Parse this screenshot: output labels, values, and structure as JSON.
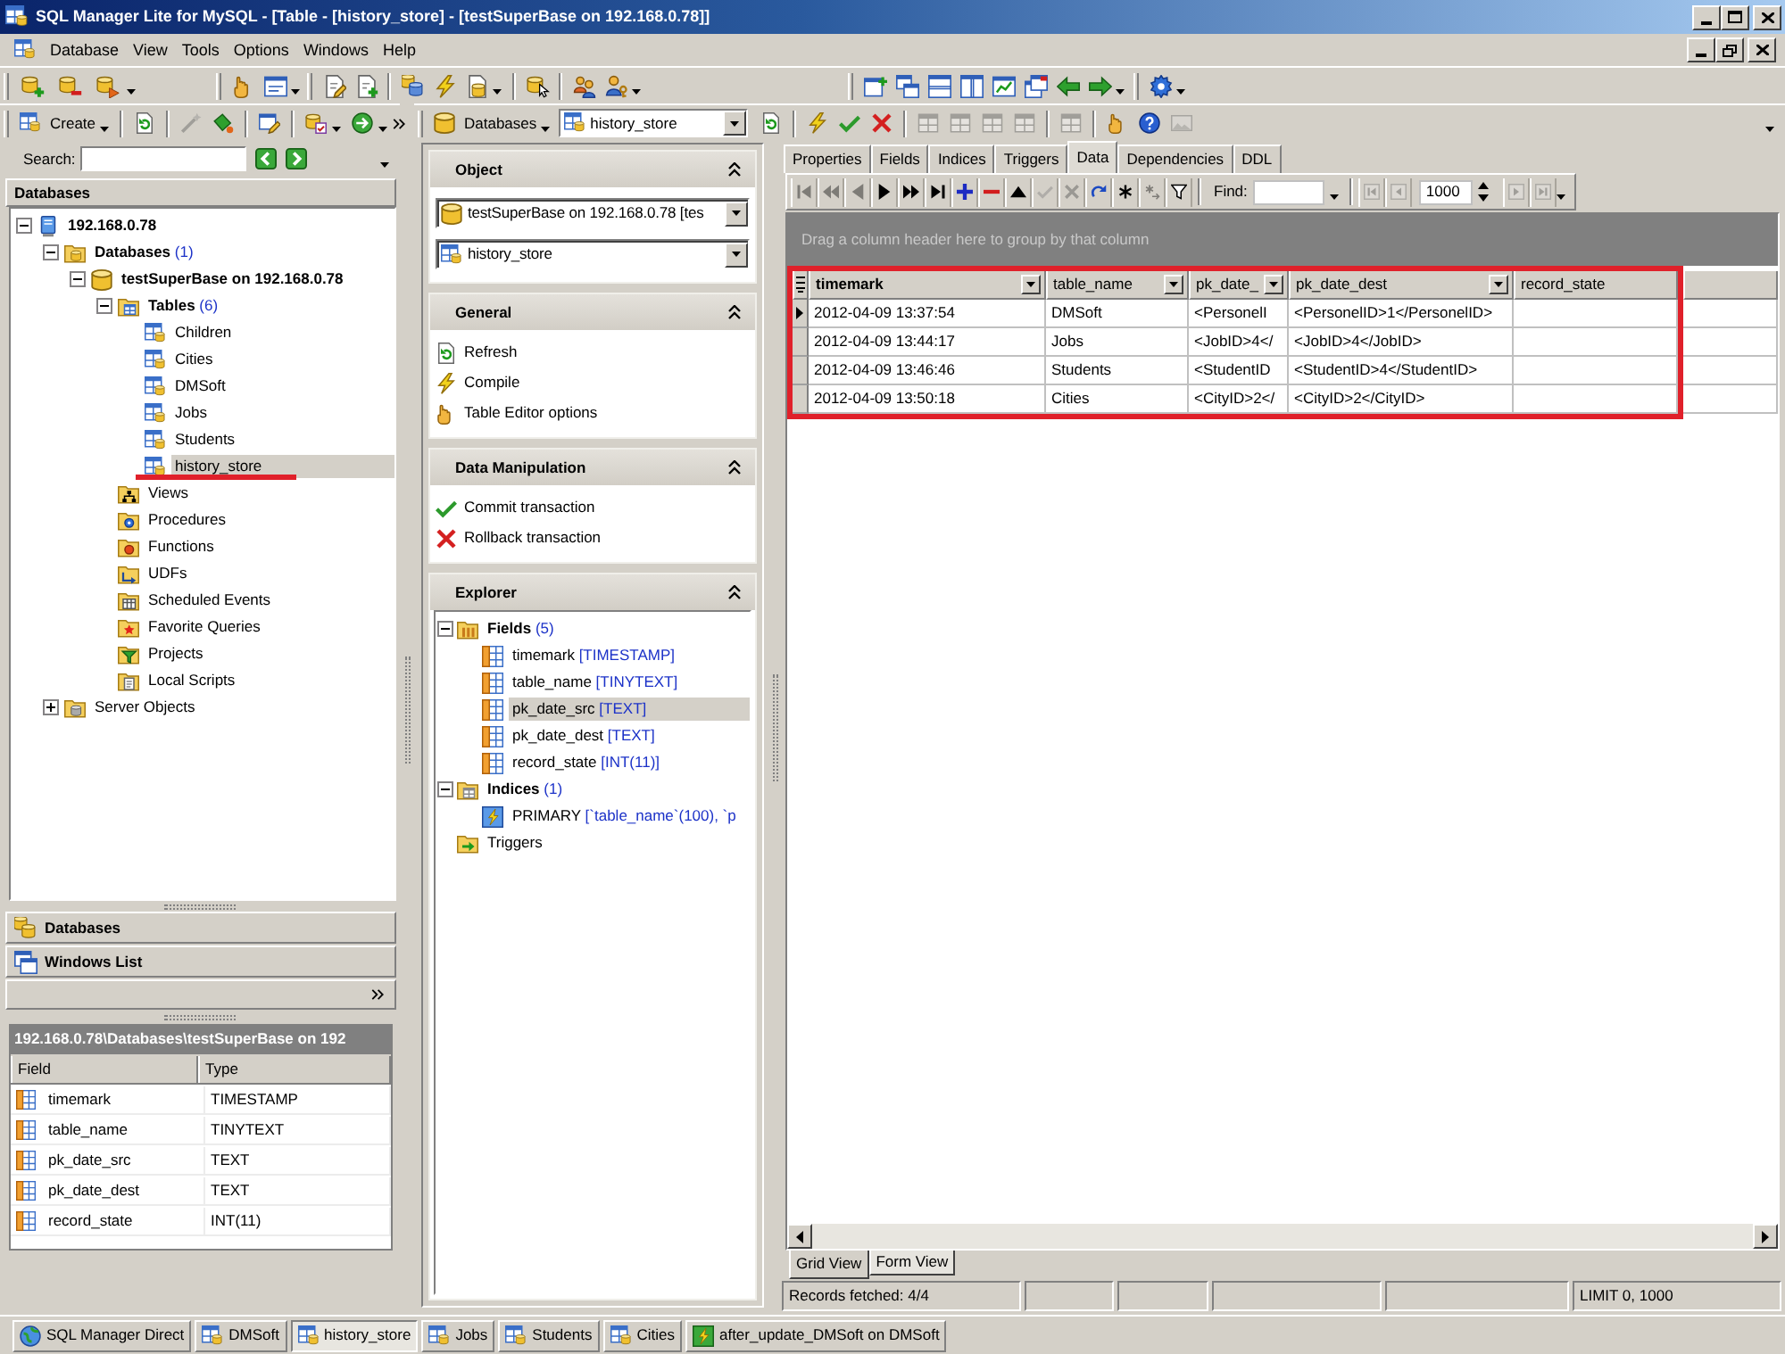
{
  "window": {
    "title": "SQL Manager Lite for MySQL - [Table - [history_store] - [testSuperBase on 192.168.0.78]]"
  },
  "menu": [
    "Database",
    "View",
    "Tools",
    "Options",
    "Windows",
    "Help"
  ],
  "main_toolbar": {
    "bands": [
      {
        "items": [
          {
            "kind": "dbplus"
          },
          {
            "kind": "dbminus"
          },
          {
            "kind": "dbarrow"
          },
          {
            "kind": "drop"
          }
        ]
      },
      {
        "items": [
          {
            "kind": "hand"
          },
          {
            "kind": "window"
          },
          {
            "kind": "drop"
          }
        ]
      },
      {
        "items": [
          {
            "kind": "edit"
          },
          {
            "kind": "newdoc"
          },
          {
            "kind": "sep"
          },
          {
            "kind": "dbconnect"
          },
          {
            "kind": "lightning"
          },
          {
            "kind": "newobj"
          },
          {
            "kind": "drop"
          },
          {
            "kind": "sep"
          },
          {
            "kind": "dbcursor"
          },
          {
            "kind": "sep"
          },
          {
            "kind": "users"
          },
          {
            "kind": "userkey"
          },
          {
            "kind": "drop"
          }
        ]
      },
      {
        "items": [
          {
            "kind": "winnew"
          },
          {
            "kind": "cascade"
          },
          {
            "kind": "tileh"
          },
          {
            "kind": "tilev"
          },
          {
            "kind": "winchart"
          },
          {
            "kind": "winclose"
          },
          {
            "kind": "back"
          },
          {
            "kind": "forward"
          },
          {
            "kind": "drop"
          }
        ]
      },
      {
        "items": [
          {
            "kind": "gear"
          },
          {
            "kind": "drop"
          }
        ]
      }
    ]
  },
  "navigator": {
    "toolbar": [
      {
        "kind": "create",
        "label": "Create",
        "disabled": false
      },
      {
        "kind": "drop"
      },
      {
        "kind": "sep"
      },
      {
        "kind": "refresh",
        "disabled": false
      },
      {
        "kind": "sep"
      },
      {
        "kind": "wand",
        "disabled": true
      },
      {
        "kind": "bucket",
        "disabled": false
      },
      {
        "kind": "sep"
      },
      {
        "kind": "props",
        "disabled": false
      },
      {
        "kind": "sep"
      },
      {
        "kind": "dbcheck",
        "disabled": false
      },
      {
        "kind": "drop"
      },
      {
        "kind": "globe",
        "disabled": false
      },
      {
        "kind": "drop"
      },
      {
        "kind": "more",
        "disabled": false
      }
    ],
    "search": {
      "label": "Search:"
    },
    "title": "Databases",
    "tree": [
      {
        "kind": "server",
        "label": "192.168.0.78",
        "expanded": true,
        "selected": false,
        "children": [
          {
            "kind": "dbfolder",
            "label": "Databases",
            "count": "(1)",
            "expanded": true,
            "selected": false,
            "children": [
              {
                "kind": "database",
                "label": "testSuperBase on 192.168.0.78",
                "expanded": true,
                "selected": false,
                "children": [
                  {
                    "kind": "tables",
                    "label": "Tables",
                    "count": "(6)",
                    "expanded": true,
                    "selected": false,
                    "children": [
                      {
                        "kind": "table",
                        "label": "Children",
                        "selected": false,
                        "underlined": false
                      },
                      {
                        "kind": "table",
                        "label": "Cities",
                        "selected": false,
                        "underlined": false
                      },
                      {
                        "kind": "table",
                        "label": "DMSoft",
                        "selected": false,
                        "underlined": false
                      },
                      {
                        "kind": "table",
                        "label": "Jobs",
                        "selected": false,
                        "underlined": false
                      },
                      {
                        "kind": "table",
                        "label": "Students",
                        "selected": false,
                        "underlined": false
                      },
                      {
                        "kind": "table",
                        "label": "history_store",
                        "selected": true,
                        "underlined": true
                      }
                    ]
                  },
                  {
                    "kind": "views",
                    "label": "Views",
                    "selected": false
                  },
                  {
                    "kind": "procedures",
                    "label": "Procedures",
                    "selected": false
                  },
                  {
                    "kind": "functions",
                    "label": "Functions",
                    "selected": false
                  },
                  {
                    "kind": "udfs",
                    "label": "UDFs",
                    "selected": false
                  },
                  {
                    "kind": "events",
                    "label": "Scheduled Events",
                    "selected": false
                  },
                  {
                    "kind": "favorites",
                    "label": "Favorite Queries",
                    "selected": false
                  },
                  {
                    "kind": "projects",
                    "label": "Projects",
                    "selected": false
                  },
                  {
                    "kind": "scripts",
                    "label": "Local Scripts",
                    "selected": false
                  }
                ]
              }
            ]
          },
          {
            "kind": "serverobjects",
            "label": "Server Objects",
            "expanded": false,
            "selected": false
          }
        ]
      }
    ],
    "panels": [
      {
        "kind": "dbstack",
        "label": "Databases"
      },
      {
        "kind": "windows",
        "label": "Windows List"
      }
    ],
    "path": "192.168.0.78\\Databases\\testSuperBase on 192",
    "fields": {
      "columns": [
        "Field",
        "Type"
      ],
      "rows": [
        [
          "timemark",
          "TIMESTAMP"
        ],
        [
          "table_name",
          "TINYTEXT"
        ],
        [
          "pk_date_src",
          "TEXT"
        ],
        [
          "pk_date_dest",
          "TEXT"
        ],
        [
          "record_state",
          "INT(11)"
        ]
      ]
    }
  },
  "object_toolbar": [
    {
      "kind": "databases",
      "label": "Databases"
    },
    {
      "kind": "drop"
    },
    {
      "kind": "combo",
      "value": "history_store"
    },
    {
      "kind": "refresh",
      "disabled": false
    },
    {
      "kind": "sep"
    },
    {
      "kind": "lightning",
      "disabled": false
    },
    {
      "kind": "commit",
      "disabled": false
    },
    {
      "kind": "rollback",
      "disabled": false
    },
    {
      "kind": "sep"
    },
    {
      "kind": "tabgrid",
      "disabled": true
    },
    {
      "kind": "tabgrid",
      "disabled": true
    },
    {
      "kind": "tabgrid",
      "disabled": true
    },
    {
      "kind": "tabgrid",
      "disabled": true
    },
    {
      "kind": "sep"
    },
    {
      "kind": "tabgrid",
      "disabled": true
    },
    {
      "kind": "sep"
    },
    {
      "kind": "hand",
      "disabled": false
    },
    {
      "kind": "help",
      "disabled": false
    },
    {
      "kind": "picture",
      "disabled": true
    }
  ],
  "sidebar": {
    "sections": [
      {
        "title": "Object",
        "kind": "combos",
        "expanded": true,
        "items": [
          {
            "kind": "database",
            "value": "testSuperBase on 192.168.0.78 [tes"
          },
          {
            "kind": "table",
            "value": "history_store"
          }
        ]
      },
      {
        "title": "General",
        "kind": "links",
        "expanded": true,
        "items": [
          {
            "kind": "refresh",
            "label": "Refresh"
          },
          {
            "kind": "lightning",
            "label": "Compile"
          },
          {
            "kind": "hand",
            "label": "Table Editor options"
          }
        ]
      },
      {
        "title": "Data Manipulation",
        "kind": "links",
        "expanded": true,
        "items": [
          {
            "kind": "commit",
            "label": "Commit transaction"
          },
          {
            "kind": "rollback",
            "label": "Rollback transaction"
          }
        ]
      },
      {
        "title": "Explorer",
        "kind": "tree",
        "expanded": true,
        "tree": [
          {
            "kind": "fields",
            "label": "Fields",
            "count": "(5)",
            "expanded": true,
            "selected": false,
            "children": [
              {
                "kind": "field",
                "label": "timemark",
                "type": "[TIMESTAMP]",
                "selected": false
              },
              {
                "kind": "field",
                "label": "table_name",
                "type": "[TINYTEXT]",
                "selected": false
              },
              {
                "kind": "field",
                "label": "pk_date_src",
                "type": "[TEXT]",
                "selected": true
              },
              {
                "kind": "field",
                "label": "pk_date_dest",
                "type": "[TEXT]",
                "selected": false
              },
              {
                "kind": "field",
                "label": "record_state",
                "type": "[INT(11)]",
                "selected": false
              }
            ]
          },
          {
            "kind": "indices",
            "label": "Indices",
            "count": "(1)",
            "expanded": true,
            "selected": false,
            "children": [
              {
                "kind": "index",
                "label": "PRIMARY",
                "type": "[`table_name`(100), `p",
                "selected": false
              }
            ]
          },
          {
            "kind": "triggers",
            "label": "Triggers",
            "selected": false
          }
        ]
      }
    ]
  },
  "editor": {
    "tabs": [
      {
        "label": "Properties",
        "selected": false
      },
      {
        "label": "Fields",
        "selected": false
      },
      {
        "label": "Indices",
        "selected": false
      },
      {
        "label": "Triggers",
        "selected": false
      },
      {
        "label": "Data",
        "selected": true
      },
      {
        "label": "Dependencies",
        "selected": false
      },
      {
        "label": "DDL",
        "selected": false
      }
    ],
    "data_toolbar": [
      {
        "kind": "first",
        "disabled": true
      },
      {
        "kind": "prevpage",
        "disabled": true
      },
      {
        "kind": "prev",
        "disabled": true
      },
      {
        "kind": "next",
        "disabled": false
      },
      {
        "kind": "nextpage",
        "disabled": false
      },
      {
        "kind": "last",
        "disabled": false
      },
      {
        "kind": "plus",
        "disabled": false
      },
      {
        "kind": "minus",
        "disabled": false
      },
      {
        "kind": "up",
        "disabled": false
      },
      {
        "kind": "commit",
        "disabled": true
      },
      {
        "kind": "rollback",
        "disabled": true
      },
      {
        "kind": "redo",
        "disabled": false
      },
      {
        "kind": "asterisk",
        "disabled": false
      },
      {
        "kind": "asterisk2",
        "disabled": true
      },
      {
        "kind": "filter",
        "disabled": false
      },
      {
        "kind": "sep"
      },
      {
        "kind": "find",
        "label": "Find:"
      },
      {
        "kind": "drop"
      },
      {
        "kind": "sep"
      },
      {
        "kind": "pagefirst",
        "disabled": true
      },
      {
        "kind": "pageback",
        "disabled": true
      },
      {
        "kind": "spin",
        "value": "1000"
      },
      {
        "kind": "pagefwd",
        "disabled": true
      },
      {
        "kind": "pagelast",
        "disabled": true
      },
      {
        "kind": "drop"
      }
    ],
    "grid": {
      "group_hint": "Drag a column header here to group by that column",
      "highlighted": true,
      "columns": [
        {
          "label": "timemark",
          "focused": true,
          "filter": true
        },
        {
          "label": "table_name",
          "focused": false,
          "filter": true
        },
        {
          "label": "pk_date_",
          "focused": false,
          "filter": true
        },
        {
          "label": "pk_date_dest",
          "focused": false,
          "filter": true
        },
        {
          "label": "record_state",
          "focused": false,
          "filter": false
        }
      ],
      "rows": [
        {
          "current": true,
          "cells": [
            "2012-04-09 13:37:54",
            "DMSoft",
            "<PersonelI",
            "<PersonelID>1</PersonelID>"
          ]
        },
        {
          "current": false,
          "cells": [
            "2012-04-09 13:44:17",
            "Jobs",
            "<JobID>4</",
            "<JobID>4</JobID>"
          ]
        },
        {
          "current": false,
          "cells": [
            "2012-04-09 13:46:46",
            "Students",
            "<StudentID",
            "<StudentID>4</StudentID>"
          ]
        },
        {
          "current": false,
          "cells": [
            "2012-04-09 13:50:18",
            "Cities",
            "<CityID>2</",
            "<CityID>2</CityID>"
          ]
        }
      ]
    },
    "view_tabs": [
      {
        "label": "Grid View",
        "selected": true
      },
      {
        "label": "Form View",
        "selected": false
      }
    ],
    "status_bar": {
      "records": "Records fetched: 4/4",
      "limit": "LIMIT 0, 1000"
    }
  },
  "taskbar": [
    {
      "kind": "direct",
      "label": "SQL Manager Direct",
      "selected": false
    },
    {
      "kind": "table",
      "label": "DMSoft",
      "selected": false
    },
    {
      "kind": "table",
      "label": "history_store",
      "selected": true
    },
    {
      "kind": "table",
      "label": "Jobs",
      "selected": false
    },
    {
      "kind": "table",
      "label": "Students",
      "selected": false
    },
    {
      "kind": "table",
      "label": "Cities",
      "selected": false
    },
    {
      "kind": "trigger",
      "label": "after_update_DMSoft on DMSoft",
      "selected": false
    }
  ]
}
